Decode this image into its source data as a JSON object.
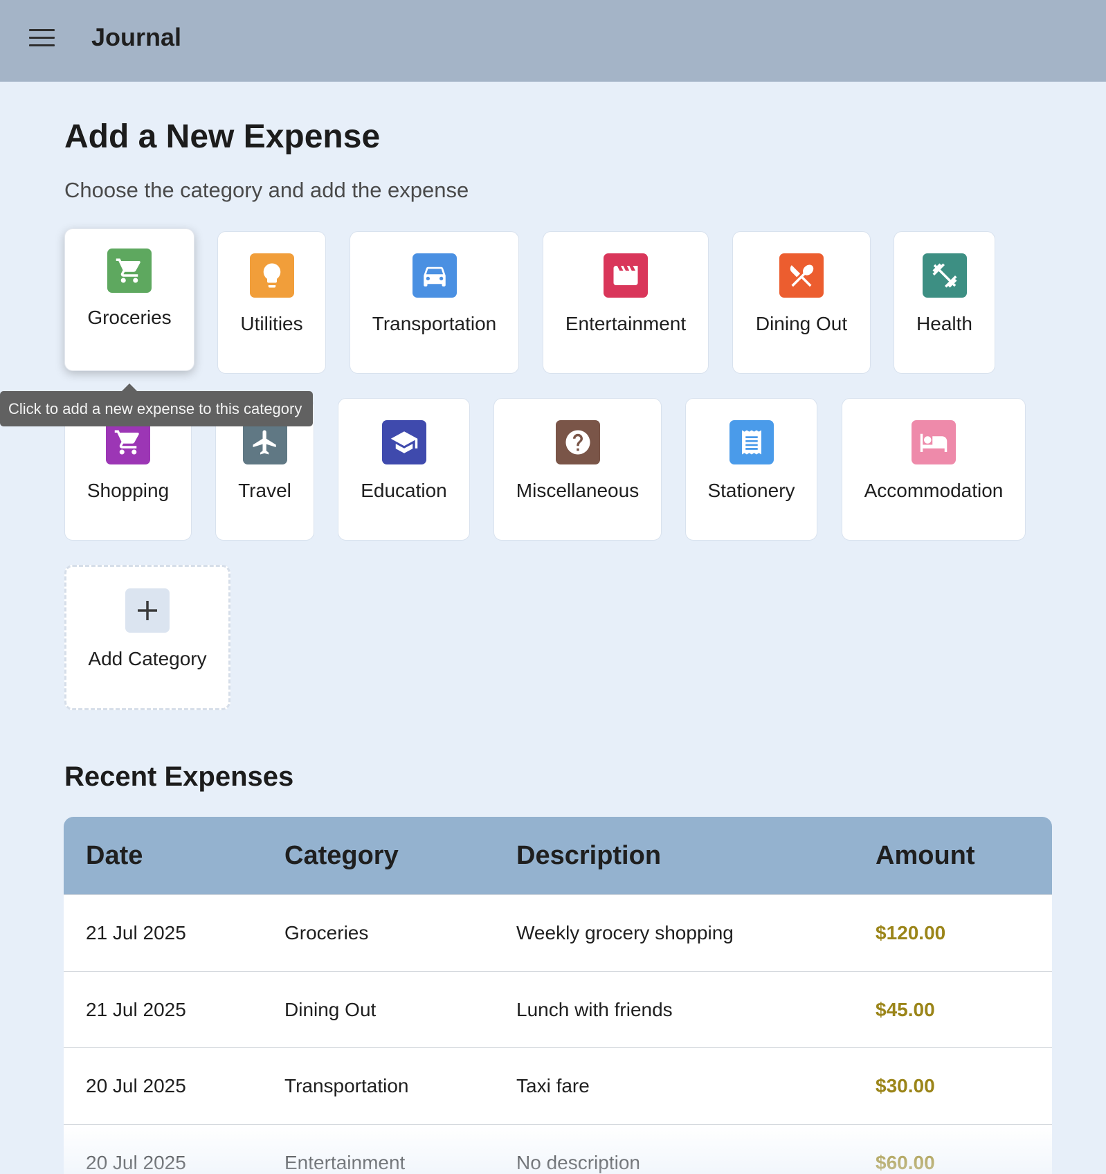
{
  "header": {
    "title": "Journal",
    "menu_icon": "hamburger-menu-icon"
  },
  "page": {
    "title": "Add a New Expense",
    "subtitle": "Choose the category and add the expense"
  },
  "categories": [
    {
      "label": "Groceries",
      "icon": "cart-icon",
      "color": "#5ea85f"
    },
    {
      "label": "Utilities",
      "icon": "lightbulb-icon",
      "color": "#f19e3a"
    },
    {
      "label": "Transportation",
      "icon": "car-icon",
      "color": "#4a90e2"
    },
    {
      "label": "Entertainment",
      "icon": "film-clapper-icon",
      "color": "#d9365a"
    },
    {
      "label": "Dining Out",
      "icon": "burger-drink-icon",
      "color": "#ec5d2f"
    },
    {
      "label": "Health",
      "icon": "dumbbell-icon",
      "color": "#3d8f83"
    },
    {
      "label": "Shopping",
      "icon": "cart-icon",
      "color": "#9c36b5"
    },
    {
      "label": "Travel",
      "icon": "airplane-icon",
      "color": "#607884"
    },
    {
      "label": "Education",
      "icon": "graduation-cap-icon",
      "color": "#3f4aad"
    },
    {
      "label": "Miscellaneous",
      "icon": "question-icon",
      "color": "#7a5548"
    },
    {
      "label": "Stationery",
      "icon": "receipt-icon",
      "color": "#4a9bea"
    },
    {
      "label": "Accommodation",
      "icon": "bed-icon",
      "color": "#ee8aaa"
    }
  ],
  "add_category": {
    "label": "Add Category",
    "icon": "plus-icon"
  },
  "tooltip": {
    "text": "Click to add a new expense to this category"
  },
  "recent": {
    "title": "Recent Expenses",
    "columns": [
      "Date",
      "Category",
      "Description",
      "Amount"
    ],
    "rows": [
      {
        "date": "21 Jul 2025",
        "category": "Groceries",
        "description": "Weekly grocery shopping",
        "amount": "$120.00"
      },
      {
        "date": "21 Jul 2025",
        "category": "Dining Out",
        "description": "Lunch with friends",
        "amount": "$45.00"
      },
      {
        "date": "20 Jul 2025",
        "category": "Transportation",
        "description": "Taxi fare",
        "amount": "$30.00"
      },
      {
        "date": "20 Jul 2025",
        "category": "Entertainment",
        "description": "No description",
        "amount": "$60.00"
      }
    ]
  },
  "colors": {
    "amount": "#9b8519",
    "header_bar": "#a4b4c7",
    "table_header": "#94b2cf"
  }
}
